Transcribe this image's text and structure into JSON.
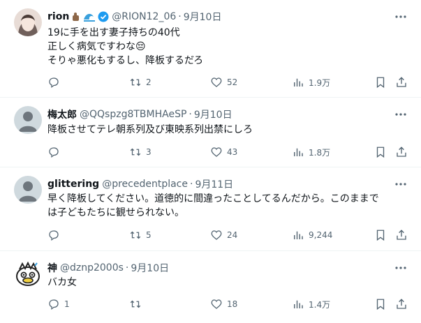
{
  "tweets": [
    {
      "name": "rion",
      "handle": "@RION12_06",
      "sep": "·",
      "time": "9月10日",
      "lines": [
        "19に手を出す妻子持ちの40代",
        "正しく病気ですわな😔",
        "そりゃ悪化もするし、降板するだろ"
      ],
      "replies": "",
      "retweets": "2",
      "likes": "52",
      "views": "1.9万"
    },
    {
      "name": "梅太郎",
      "handle": "@QQspzg8TBMHAeSP",
      "sep": "·",
      "time": "9月10日",
      "lines": [
        "降板させてテレ朝系列及び東映系列出禁にしろ"
      ],
      "replies": "",
      "retweets": "3",
      "likes": "43",
      "views": "1.8万"
    },
    {
      "name": "glittering",
      "handle": "@precedentplace",
      "sep": "·",
      "time": "9月11日",
      "lines": [
        "早く降板してください。道徳的に間違ったことしてるんだから。このままで",
        "は子どもたちに観せられない。"
      ],
      "replies": "",
      "retweets": "5",
      "likes": "24",
      "views": "9,244"
    },
    {
      "name": "神",
      "handle": "@dznp2000s",
      "sep": "·",
      "time": "9月10日",
      "lines": [
        "バカ女"
      ],
      "replies": "1",
      "retweets": "",
      "likes": "18",
      "views": "1.4万"
    }
  ],
  "icons": {
    "reply": "reply-icon",
    "retweet": "retweet-icon",
    "like": "heart-icon",
    "views": "views-icon",
    "bookmark": "bookmark-icon",
    "share": "share-icon",
    "more": "more-icon"
  },
  "colors": {
    "text": "#0f1419",
    "muted": "#536471",
    "border": "#eff3f4",
    "verified": "#1d9bf0"
  }
}
